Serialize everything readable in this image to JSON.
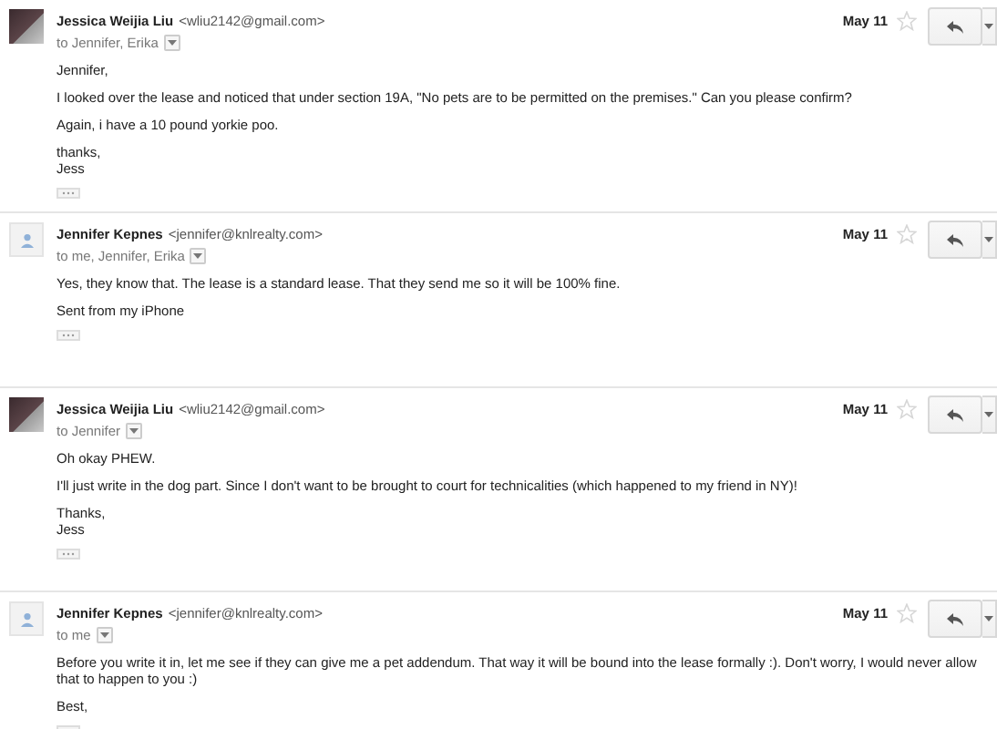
{
  "messages": [
    {
      "sender": "Jessica Weijia Liu",
      "email": "<wliu2142@gmail.com>",
      "recipients": "to Jennifer, Erika",
      "date": "May 11",
      "starred": false,
      "avatar": {
        "kind": "photo"
      },
      "paragraphs": [
        "Jennifer,",
        "I looked over the lease and noticed that under section 19A, \"No pets are to be permitted on the premises.\"  Can you please confirm?",
        "Again, i have a 10 pound yorkie poo.",
        "thanks,\nJess"
      ]
    },
    {
      "sender": "Jennifer Kepnes",
      "email": "<jennifer@knlrealty.com>",
      "recipients": "to me, Jennifer, Erika",
      "date": "May 11",
      "starred": false,
      "avatar": {
        "kind": "default"
      },
      "paragraphs": [
        "Yes, they know that. The lease is a standard lease. That they send me so it will be 100% fine.",
        "Sent from my iPhone"
      ]
    },
    {
      "sender": "Jessica Weijia Liu",
      "email": "<wliu2142@gmail.com>",
      "recipients": "to Jennifer",
      "date": "May 11",
      "starred": false,
      "avatar": {
        "kind": "photo"
      },
      "paragraphs": [
        "Oh okay PHEW.",
        "I'll just write in the dog part. Since I don't want to be brought to court for technicalities (which happened to my friend in NY)!",
        "Thanks,\nJess"
      ]
    },
    {
      "sender": "Jennifer Kepnes",
      "email": "<jennifer@knlrealty.com>",
      "recipients": "to me",
      "date": "May 11",
      "starred": false,
      "avatar": {
        "kind": "default"
      },
      "paragraphs": [
        "Before you write it in, let me see if they can give me a pet addendum. That way it will be bound into the lease formally :). Don't worry, I would never allow that to happen to you :)",
        "Best,"
      ]
    }
  ]
}
